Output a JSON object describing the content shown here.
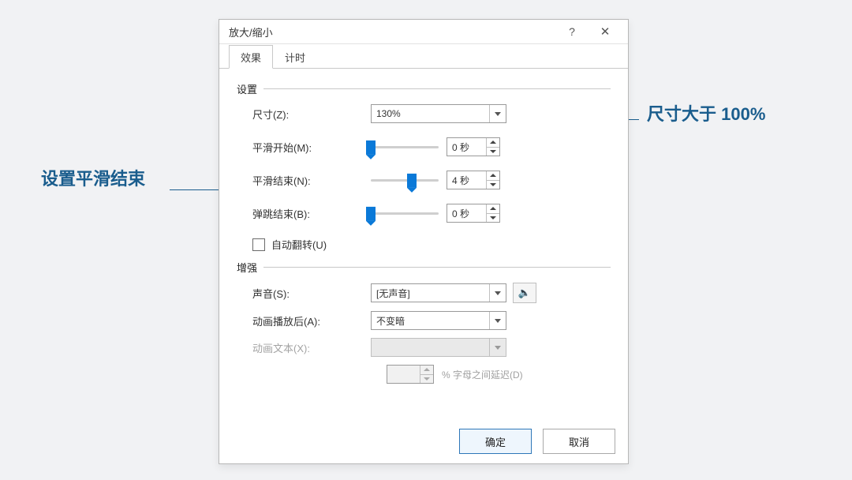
{
  "annotations": {
    "left": "设置平滑结束",
    "right": "尺寸大于 100%"
  },
  "dialog": {
    "title": "放大/缩小",
    "help_glyph": "?",
    "close_glyph": "✕",
    "tabs": {
      "effect": "效果",
      "timing": "计时"
    },
    "group_settings": "设置",
    "group_enhance": "增强",
    "size": {
      "label": "尺寸(Z):",
      "value": "130%"
    },
    "smooth_start": {
      "label": "平滑开始(M):",
      "value": "0 秒",
      "pos": 0
    },
    "smooth_end": {
      "label": "平滑结束(N):",
      "value": "4 秒",
      "pos": 60
    },
    "bounce_end": {
      "label": "弹跳结束(B):",
      "value": "0 秒",
      "pos": 0
    },
    "auto_reverse": "自动翻转(U)",
    "sound": {
      "label": "声音(S):",
      "value": "[无声音]"
    },
    "after_anim": {
      "label": "动画播放后(A):",
      "value": "不变暗"
    },
    "anim_text": {
      "label": "动画文本(X):",
      "value": ""
    },
    "delay_text": "% 字母之间延迟(D)",
    "buttons": {
      "ok": "确定",
      "cancel": "取消"
    },
    "speaker_glyph": "🔈"
  }
}
